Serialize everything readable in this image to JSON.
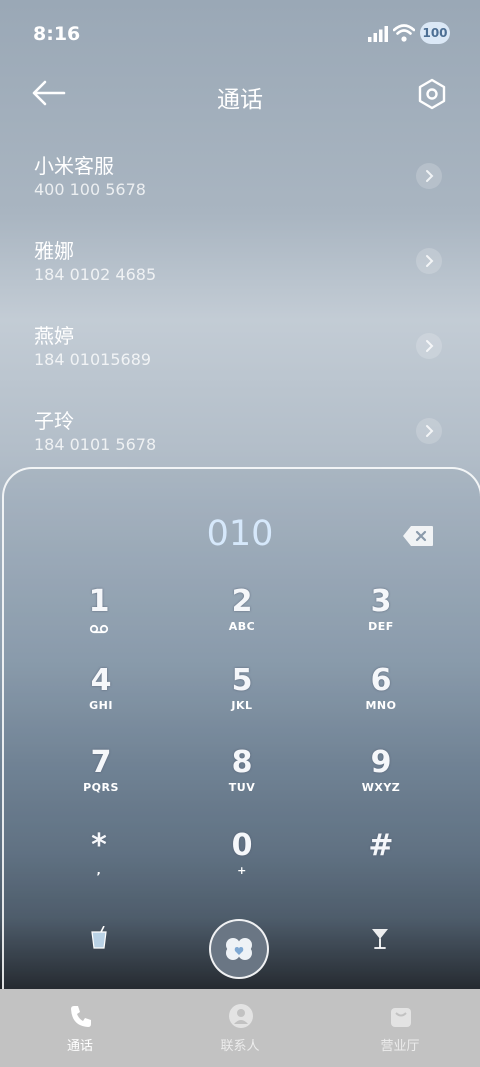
{
  "status": {
    "time": "8:16",
    "battery": "100"
  },
  "header": {
    "title": "通话"
  },
  "recents": [
    {
      "name": "小米客服",
      "number": "400 100 5678"
    },
    {
      "name": "雅娜",
      "number": "184 0102 4685"
    },
    {
      "name": "燕婷",
      "number": "184 01015689"
    },
    {
      "name": "子玲",
      "number": "184 0101 5678"
    }
  ],
  "dialer": {
    "input": "010",
    "keys": [
      {
        "digit": "1",
        "letters": ""
      },
      {
        "digit": "2",
        "letters": "ABC"
      },
      {
        "digit": "3",
        "letters": "DEF"
      },
      {
        "digit": "4",
        "letters": "GHI"
      },
      {
        "digit": "5",
        "letters": "JKL"
      },
      {
        "digit": "6",
        "letters": "MNO"
      },
      {
        "digit": "7",
        "letters": "PQRS"
      },
      {
        "digit": "8",
        "letters": "TUV"
      },
      {
        "digit": "9",
        "letters": "WXYZ"
      },
      {
        "digit": "*",
        "letters": ","
      },
      {
        "digit": "0",
        "letters": "+"
      },
      {
        "digit": "#",
        "letters": ""
      }
    ]
  },
  "tabs": [
    {
      "label": "通话",
      "icon": "phone-icon",
      "active": true
    },
    {
      "label": "联系人",
      "icon": "person-icon",
      "active": false
    },
    {
      "label": "营业厅",
      "icon": "bag-icon",
      "active": false
    }
  ],
  "colors": {
    "accent": "#d6e8fb",
    "tab_active": "#ffffff",
    "tab_inactive": "#e6e6e6"
  }
}
